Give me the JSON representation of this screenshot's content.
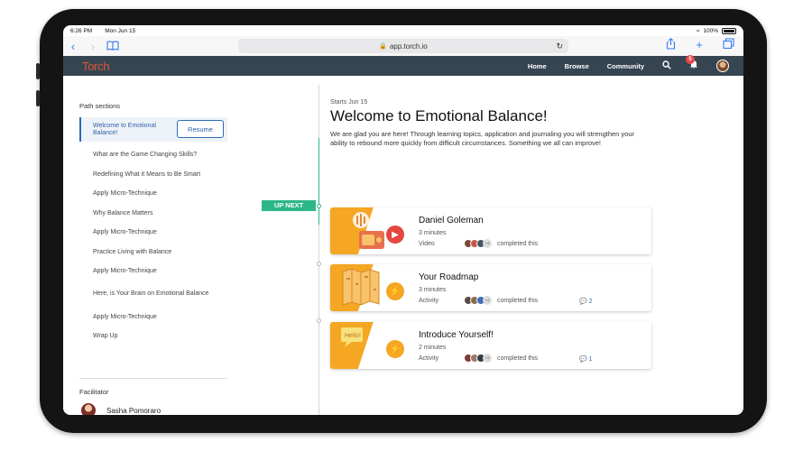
{
  "status_bar": {
    "time": "6:26 PM",
    "date": "Mon Jun 15",
    "battery": "100%",
    "battery_level": 1.0
  },
  "browser": {
    "url": "app.torch.io",
    "icons": [
      "back-icon",
      "forward-icon",
      "bookmarks-icon",
      "lock-icon",
      "reload-icon",
      "share-icon",
      "new-tab-icon",
      "tabs-icon"
    ]
  },
  "app_nav": {
    "logo": "Torch",
    "links": [
      "Home",
      "Browse",
      "Community"
    ],
    "notification_count": "5"
  },
  "sidebar": {
    "heading": "Path sections",
    "resume_label": "Resume",
    "sections": [
      {
        "label": "Welcome to Emotional Balance!",
        "active": true
      },
      {
        "label": "What are the Game Changing Skills?"
      },
      {
        "label": "Redefining What it Means to Be Smart"
      },
      {
        "label": "Apply Micro-Technique"
      },
      {
        "label": "Why Balance Matters"
      },
      {
        "label": "Apply Micro-Technique"
      },
      {
        "label": "Practice Living with Balance"
      },
      {
        "label": "Apply Micro-Technique"
      },
      {
        "label": "Here, is Your Brain on Emotional Balance"
      },
      {
        "label": "Apply Micro-Technique"
      },
      {
        "label": "Wrap Up"
      }
    ],
    "facilitator_heading": "Facilitator",
    "facilitator_name": "Sasha Pomoraro"
  },
  "timeline": {
    "up_next_label": "UP NEXT"
  },
  "main": {
    "date": "Starts Jun 15",
    "title": "Welcome to Emotional Balance!",
    "description": "We are glad you are here! Through learning topics, application and journaling you will strengthen your ability to rebound more quickly from difficult circumstances. Something we all can improve!",
    "completed_label": "completed this",
    "cards": [
      {
        "title": "Daniel Goleman",
        "duration": "3 minutes",
        "kind": "Video",
        "type_icon": "play-icon",
        "icon_color": "#e4473f",
        "comments": ""
      },
      {
        "title": "Your Roadmap",
        "duration": "3 minutes",
        "kind": "Activity",
        "type_icon": "lightning-icon",
        "icon_color": "#f5a623",
        "comments": "2"
      },
      {
        "title": "Introduce Yourself!",
        "duration": "2 minutes",
        "kind": "Activity",
        "type_icon": "lightning-icon",
        "icon_color": "#f5a623",
        "comments": "1"
      }
    ],
    "avatar_overflow": "+4"
  },
  "colors": {
    "nav_bg": "#364552",
    "brand": "#e4563c",
    "accent_green": "#2db787",
    "accent_blue": "#2b6db5",
    "card_orange": "#f5a623"
  }
}
